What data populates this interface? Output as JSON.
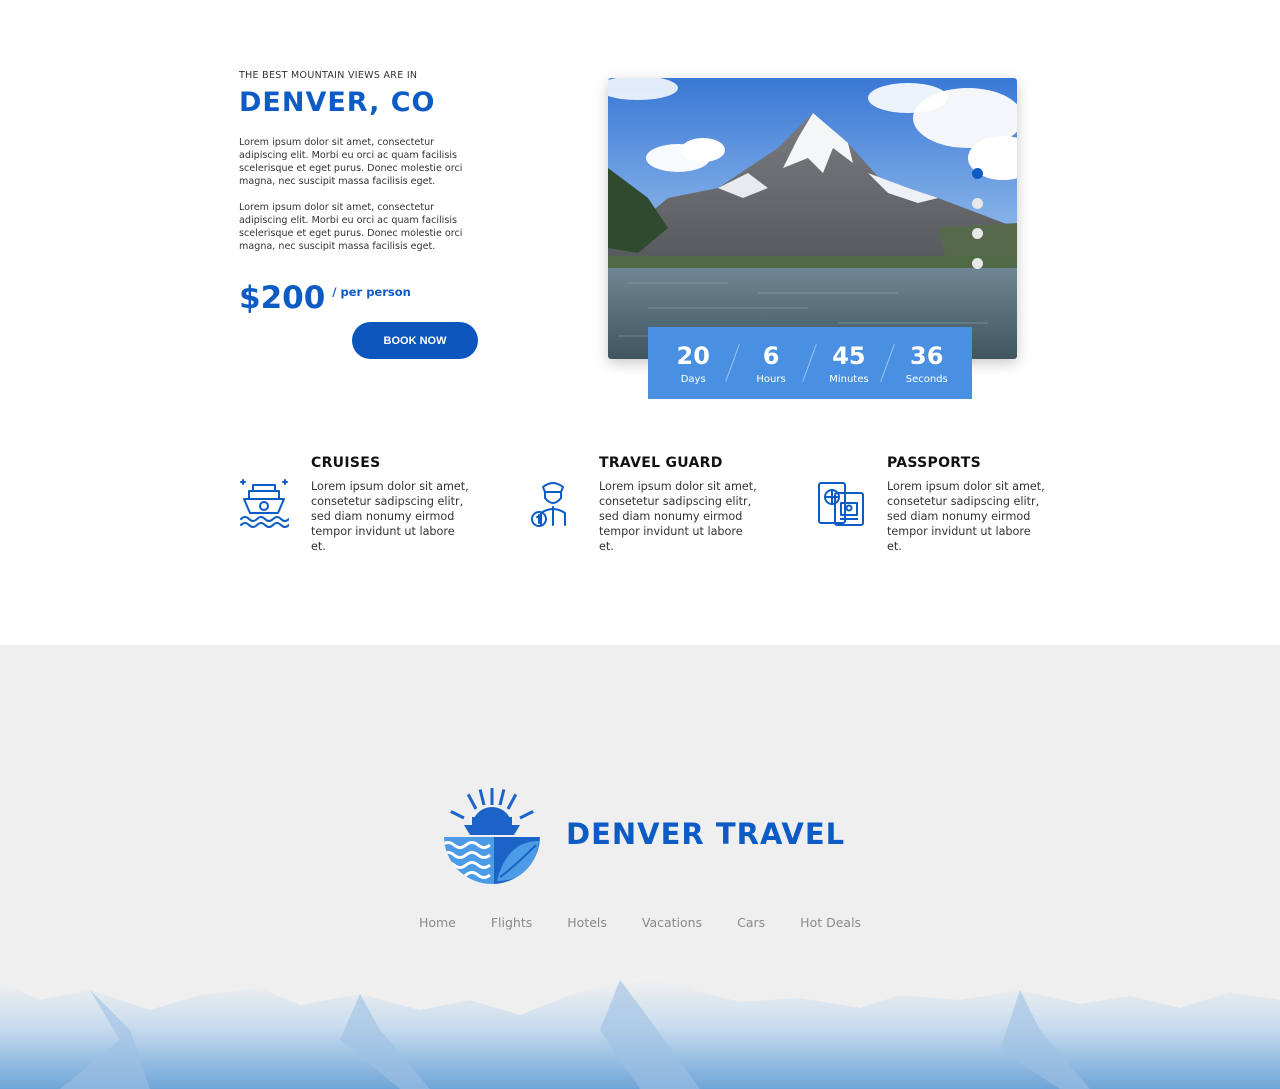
{
  "hero": {
    "kicker": "THE BEST MOUNTAIN VIEWS ARE IN",
    "city": "DENVER, CO",
    "paragraphs": [
      "Lorem ipsum dolor sit amet, consectetur adipiscing elit. Morbi eu orci ac quam facilisis scelerisque et eget purus. Donec molestie orci magna, nec suscipit massa facilisis eget.",
      "Lorem ipsum dolor sit amet, consectetur adipiscing elit. Morbi eu orci ac quam facilisis scelerisque et eget purus. Donec molestie orci magna, nec suscipit massa facilisis eget."
    ],
    "price": "$200",
    "price_unit": "/ per person",
    "book_label": "BOOK NOW",
    "slider": {
      "slide_count": 4,
      "active_index": 0
    },
    "countdown": [
      {
        "value": "20",
        "label": "Days"
      },
      {
        "value": "6",
        "label": "Hours"
      },
      {
        "value": "45",
        "label": "Minutes"
      },
      {
        "value": "36",
        "label": "Seconds"
      }
    ]
  },
  "features": [
    {
      "icon": "cruise-ship-icon",
      "title": "CRUISES",
      "text": "Lorem ipsum dolor sit amet, consetetur sadipscing elitr, sed diam nonumy eirmod tempor invidunt ut labore et."
    },
    {
      "icon": "travel-guard-icon",
      "title": "TRAVEL GUARD",
      "text": "Lorem ipsum dolor sit amet, consetetur sadipscing elitr, sed diam nonumy eirmod tempor invidunt ut labore et."
    },
    {
      "icon": "passport-icon",
      "title": "PASSPORTS",
      "text": "Lorem ipsum dolor sit amet, consetetur sadipscing elitr, sed diam nonumy eirmod tempor invidunt ut labore et."
    }
  ],
  "footer": {
    "brand": "DENVER TRAVEL",
    "nav": [
      "Home",
      "Flights",
      "Hotels",
      "Vacations",
      "Cars",
      "Hot Deals"
    ]
  },
  "colors": {
    "brand_blue": "#0d5cc5",
    "countdown_blue": "#4a90e2",
    "footer_bg": "#efefef",
    "nav_text": "#8a8a8a"
  }
}
